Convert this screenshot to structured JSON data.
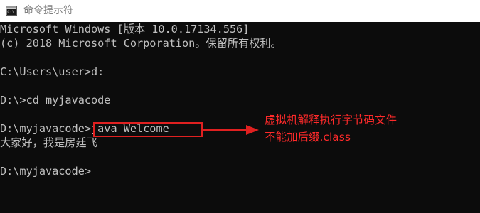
{
  "window": {
    "title": "命令提示符",
    "icon": "command-prompt-icon"
  },
  "console": {
    "lines": [
      "Microsoft Windows [版本 10.0.17134.556]",
      "(c) 2018 Microsoft Corporation。保留所有权利。",
      "",
      "C:\\Users\\user>d:",
      "",
      "D:\\>cd myjavacode",
      "",
      "D:\\myjavacode>java Welcome",
      "大家好，我是房廷飞",
      "",
      "D:\\myjavacode>"
    ]
  },
  "annotation": {
    "line1": "虚拟机解释执行字节码文件",
    "line2": "不能加后缀.class",
    "color": "#ff2a2a"
  },
  "colors": {
    "console_bg": "#0c0c0c",
    "console_text": "#c0c0c0",
    "title_text": "#808080"
  }
}
